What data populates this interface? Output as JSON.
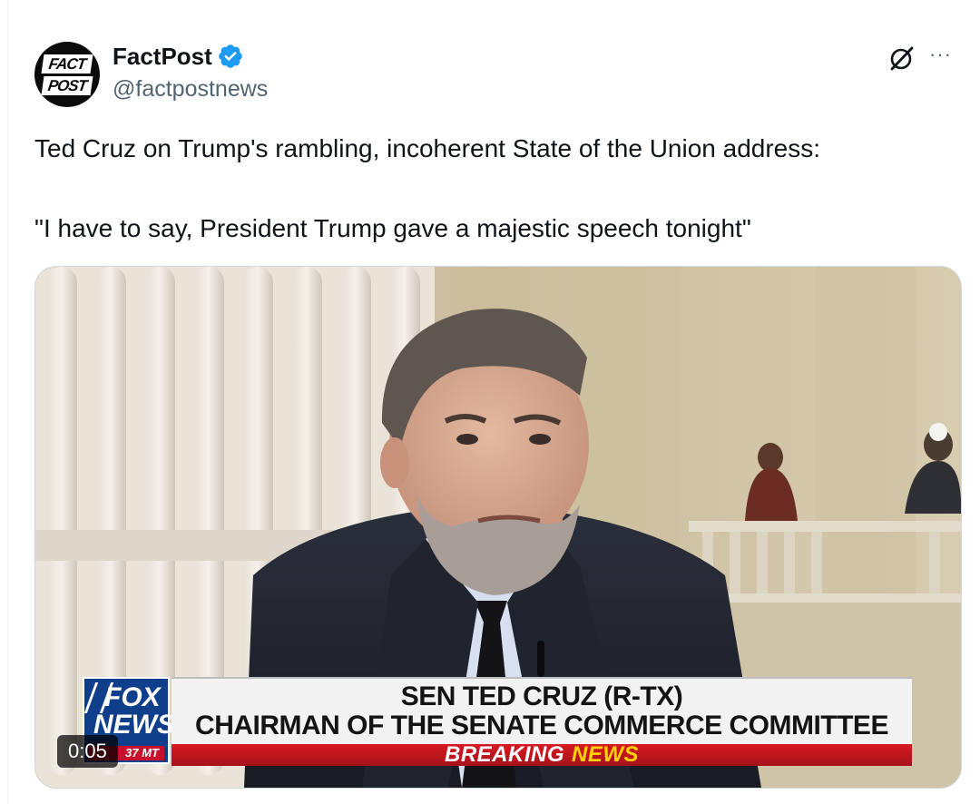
{
  "author": {
    "display_name": "FactPost",
    "handle": "@factpostnews",
    "verified": true,
    "avatar_text": [
      "FACT",
      "POST"
    ]
  },
  "icons": {
    "verified": "verified-badge-icon",
    "grok": "grok-icon",
    "more": "more-options-icon"
  },
  "more_label": "···",
  "tweet": {
    "line1": "Ted Cruz on Trump's rambling, incoherent State of the Union address:",
    "line2": "\"I have to say, President Trump gave a majestic speech tonight\""
  },
  "video": {
    "timestamp": "0:05",
    "logo_top": "FOX",
    "logo_bottom": "NEWS",
    "logo_time": "37 MT",
    "chyron_line1": "SEN TED CRUZ (R-TX)",
    "chyron_line2": "CHAIRMAN OF THE SENATE COMMERCE COMMITTEE",
    "banner_word1": "BREAKING",
    "banner_word2": "NEWS"
  },
  "colors": {
    "verified_blue": "#1d9bf0",
    "text_primary": "#0f1419",
    "text_secondary": "#536471",
    "fox_red": "#c8102e",
    "fox_blue": "#0f3e8a",
    "news_yellow": "#ffd200"
  }
}
